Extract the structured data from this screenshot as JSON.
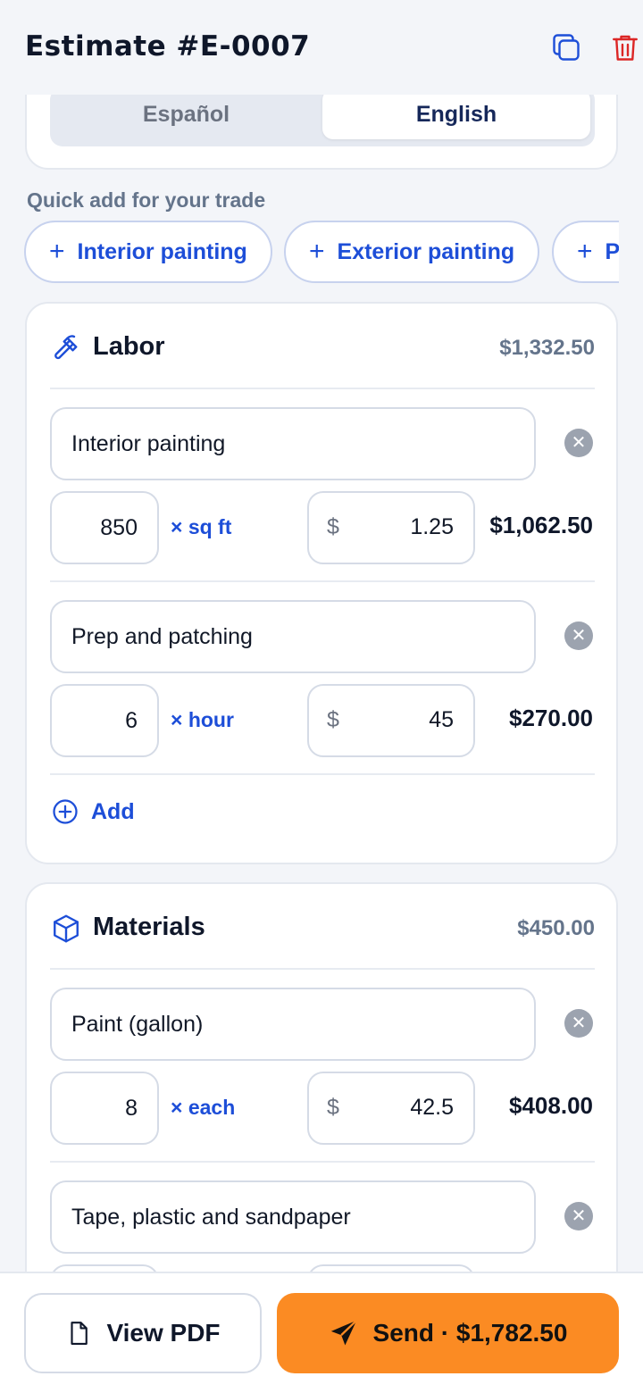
{
  "header": {
    "title": "Estimate #E-0007",
    "copy_icon": "copy-icon",
    "trash_icon": "trash-icon"
  },
  "language": {
    "options": [
      "Español",
      "English"
    ],
    "selected": "English"
  },
  "quick_add": {
    "label": "Quick add for your trade",
    "chips": [
      "Interior painting",
      "Exterior painting",
      "P"
    ]
  },
  "sections": [
    {
      "title": "Labor",
      "icon": "hammer-icon",
      "total": "$1,332.50",
      "items": [
        {
          "description": "Interior painting",
          "qty": "850",
          "unit": "× sq ft",
          "currency": "$",
          "price": "1.25",
          "total": "$1,062.50"
        },
        {
          "description": "Prep and patching",
          "qty": "6",
          "unit": "× hour",
          "currency": "$",
          "price": "45",
          "total": "$270.00"
        }
      ],
      "add_label": "Add"
    },
    {
      "title": "Materials",
      "icon": "box-icon",
      "total": "$450.00",
      "items": [
        {
          "description": "Paint (gallon)",
          "qty": "8",
          "unit": "× each",
          "currency": "$",
          "price": "42.5",
          "total": "$408.00"
        },
        {
          "description": "Tape, plastic and sandpaper",
          "qty": "",
          "unit": "",
          "currency": "",
          "price": "",
          "total": ""
        }
      ]
    }
  ],
  "footer": {
    "pdf_label": "View PDF",
    "send_label": "Send · $1,782.50"
  },
  "colors": {
    "accent": "#1d4ed8",
    "send": "#fb8b23",
    "danger": "#dc2626"
  }
}
